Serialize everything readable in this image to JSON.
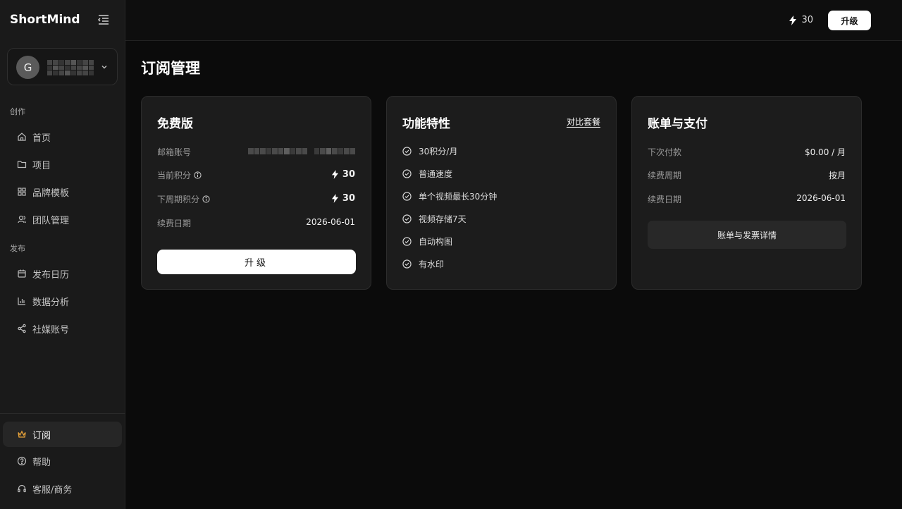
{
  "app": {
    "brand": "ShortMind"
  },
  "user": {
    "avatar_letter": "G"
  },
  "sidebar": {
    "sections": [
      {
        "label": "创作",
        "items": [
          {
            "label": "首页",
            "icon": "home-icon"
          },
          {
            "label": "项目",
            "icon": "folder-icon"
          },
          {
            "label": "品牌模板",
            "icon": "grid-icon"
          },
          {
            "label": "团队管理",
            "icon": "team-icon"
          }
        ]
      },
      {
        "label": "发布",
        "items": [
          {
            "label": "发布日历",
            "icon": "calendar-icon"
          },
          {
            "label": "数据分析",
            "icon": "chart-icon"
          },
          {
            "label": "社媒账号",
            "icon": "share-icon"
          }
        ]
      }
    ],
    "bottom": [
      {
        "label": "订阅",
        "icon": "crown-icon",
        "active": true
      },
      {
        "label": "帮助",
        "icon": "help-icon"
      },
      {
        "label": "客服/商务",
        "icon": "headset-icon"
      }
    ]
  },
  "topbar": {
    "credits": "30",
    "upgrade_label": "升级"
  },
  "page": {
    "title": "订阅管理"
  },
  "plan_card": {
    "title": "免费版",
    "email_label": "邮箱账号",
    "current_credits_label": "当前积分",
    "current_credits_value": "30",
    "next_credits_label": "下周期积分",
    "next_credits_value": "30",
    "renew_label": "续费日期",
    "renew_value": "2026-06-01",
    "upgrade_label": "升级"
  },
  "features_card": {
    "title": "功能特性",
    "compare_label": "对比套餐",
    "features": [
      "30积分/月",
      "普通速度",
      "单个视频最长30分钟",
      "视频存储7天",
      "自动构图",
      "有水印"
    ]
  },
  "billing_card": {
    "title": "账单与支付",
    "rows": [
      {
        "label": "下次付款",
        "value": "$0.00 / 月"
      },
      {
        "label": "续费周期",
        "value": "按月"
      },
      {
        "label": "续费日期",
        "value": "2026-06-01"
      }
    ],
    "details_label": "账单与发票详情"
  },
  "colors": {
    "accent_active_icon": "#e8a33a",
    "background": "#0b0b0b",
    "card": "#1c1c1c"
  }
}
